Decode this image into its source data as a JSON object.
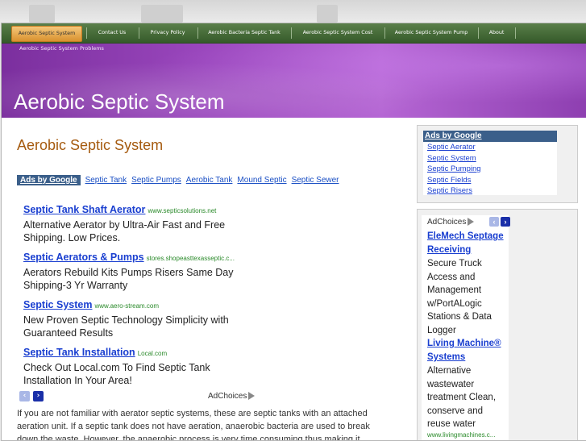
{
  "nav": {
    "items": [
      "Aerobic Septic System",
      "Contact Us",
      "Privacy Policy",
      "Aerobic Bacteria Septic Tank",
      "Aerobic Septic System Cost",
      "Aerobic Septic System Pump",
      "About"
    ],
    "sub_item": "Aerobic Septic System Problems"
  },
  "banner": {
    "title": "Aerobic Septic System"
  },
  "main": {
    "heading": "Aerobic Septic System",
    "ads_by_google": "Ads by Google",
    "ad_links": [
      "Septic Tank",
      "Septic Pumps",
      "Aerobic Tank",
      "Mound Septic",
      "Septic Sewer"
    ],
    "ads": [
      {
        "title": "Septic Tank Shaft Aerator",
        "url": "www.septicsolutions.net",
        "desc": "Alternative Aerator by Ultra-Air Fast and Free Shipping. Low Prices."
      },
      {
        "title": "Septic Aerators & Pumps",
        "url": "stores.shopeasttexasseptic.c...",
        "desc": "Aerators Rebuild Kits Pumps Risers Same Day Shipping-3 Yr Warranty"
      },
      {
        "title": "Septic System",
        "url": "www.aero-stream.com",
        "desc": "New Proven Septic Technology Simplicity with Guaranteed Results"
      },
      {
        "title": "Septic Tank Installation",
        "url": "Local.com",
        "desc": "Check Out Local.com To Find Septic Tank Installation In Your Area!"
      }
    ],
    "adchoices": "AdChoices",
    "body_text": "If you are not familiar with aerator septic systems, these are septic tanks with an attached aeration unit. If a septic tank does not have aeration, anaerobic bacteria are used to break down the waste. However, the anaerobic process is very time consuming thus making it"
  },
  "sidebar": {
    "ads_by_google": "Ads by Google",
    "links": [
      "Septic Aerator",
      "Septic System",
      "Septic Pumping",
      "Septic Fields",
      "Septic Risers"
    ],
    "adchoices": "AdChoices",
    "ads": [
      {
        "title": "EleMech Septage Receiving",
        "desc": "Secure Truck Access and Management w/PortALogic Stations & Data Logger"
      },
      {
        "title": "Living Machine® Systems",
        "desc": "Alternative wastewater treatment Clean, conserve and reuse water",
        "url": "www.livingmachines.c..."
      }
    ]
  },
  "colors": {
    "nav_bg": "#355a2a",
    "nav_active": "#d9922f",
    "banner": "#9a47bd",
    "heading": "#a55a0f",
    "link": "#1a3fd0"
  }
}
